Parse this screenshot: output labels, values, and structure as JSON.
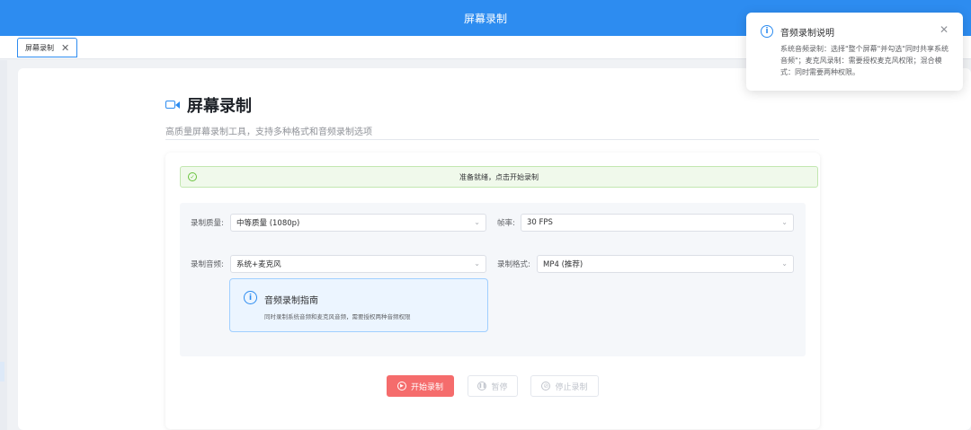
{
  "app": {
    "title": "屏幕录制"
  },
  "tabs": [
    {
      "label": "屏幕录制",
      "close_icon": "close-icon"
    }
  ],
  "page": {
    "heading": "屏幕录制",
    "subtitle": "高质量屏幕录制工具，支持多种格式和音频录制选项",
    "heading_icon": "video-camera-icon"
  },
  "status_alert": {
    "text": "准备就绪，点击开始录制",
    "icon": "check-circle-icon",
    "color": "#67c23a"
  },
  "form": {
    "quality": {
      "label": "录制质量:",
      "value": "中等质量 (1080p)"
    },
    "fps": {
      "label": "帧率:",
      "value": "30 FPS"
    },
    "audio": {
      "label": "录制音频:",
      "value": "系统+麦克风"
    },
    "format": {
      "label": "录制格式:",
      "value": "MP4 (推荐)"
    }
  },
  "audio_guide": {
    "title": "音频录制指南",
    "description": "同时录制系统音频和麦克风音频，需要授权两种音频权限",
    "icon": "info-icon"
  },
  "buttons": {
    "start": {
      "label": "开始录制",
      "icon": "play-circle-icon",
      "color": "#f56c6c"
    },
    "pause": {
      "label": "暂停",
      "icon": "pause-circle-icon",
      "disabled": true
    },
    "stop": {
      "label": "停止录制",
      "icon": "stop-icon",
      "disabled": true
    }
  },
  "notification": {
    "title": "音频录制说明",
    "body": "系统音频录制：选择\"整个屏幕\"并勾选\"同时共享系统音频\"；麦克风录制：需要授权麦克风权限；混合模式：同时需要两种权限。",
    "icon": "info-icon"
  },
  "colors": {
    "primary": "#2d8cf0",
    "danger": "#f56c6c",
    "success": "#67c23a"
  }
}
